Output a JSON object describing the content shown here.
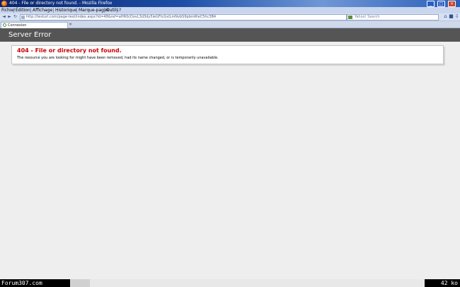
{
  "window": {
    "title": "404 - File or directory not found. - Mozilla Firefox",
    "minimize": "_",
    "maximize": "□",
    "close": "×"
  },
  "menu": {
    "items": [
      "Fichier",
      "Édition",
      "Affichage",
      "Historique",
      "Marque-pages",
      "Outils",
      "?"
    ]
  },
  "nav": {
    "back": "◄",
    "forward": "►",
    "reload": "↻",
    "stop": "■",
    "home": "⌂",
    "url": "http://testurl.com/page-test/index.aspx?id=48&ref=aHR0cDovL3d3dy5leGFtcGxlLmNvbS9pbmRleC5hc3B4",
    "search_placeholder": "Yahoo! Search",
    "download": "⇩"
  },
  "tab": {
    "label": "Connexion",
    "close": "×"
  },
  "page": {
    "header": "Server Error",
    "error_title": "404 - File or directory not found.",
    "error_text": "The resource you are looking for might have been removed, had its name changed, or is temporarily unavailable."
  },
  "overlay": {
    "watermark": "Forum307.com",
    "size": "42 ko"
  }
}
